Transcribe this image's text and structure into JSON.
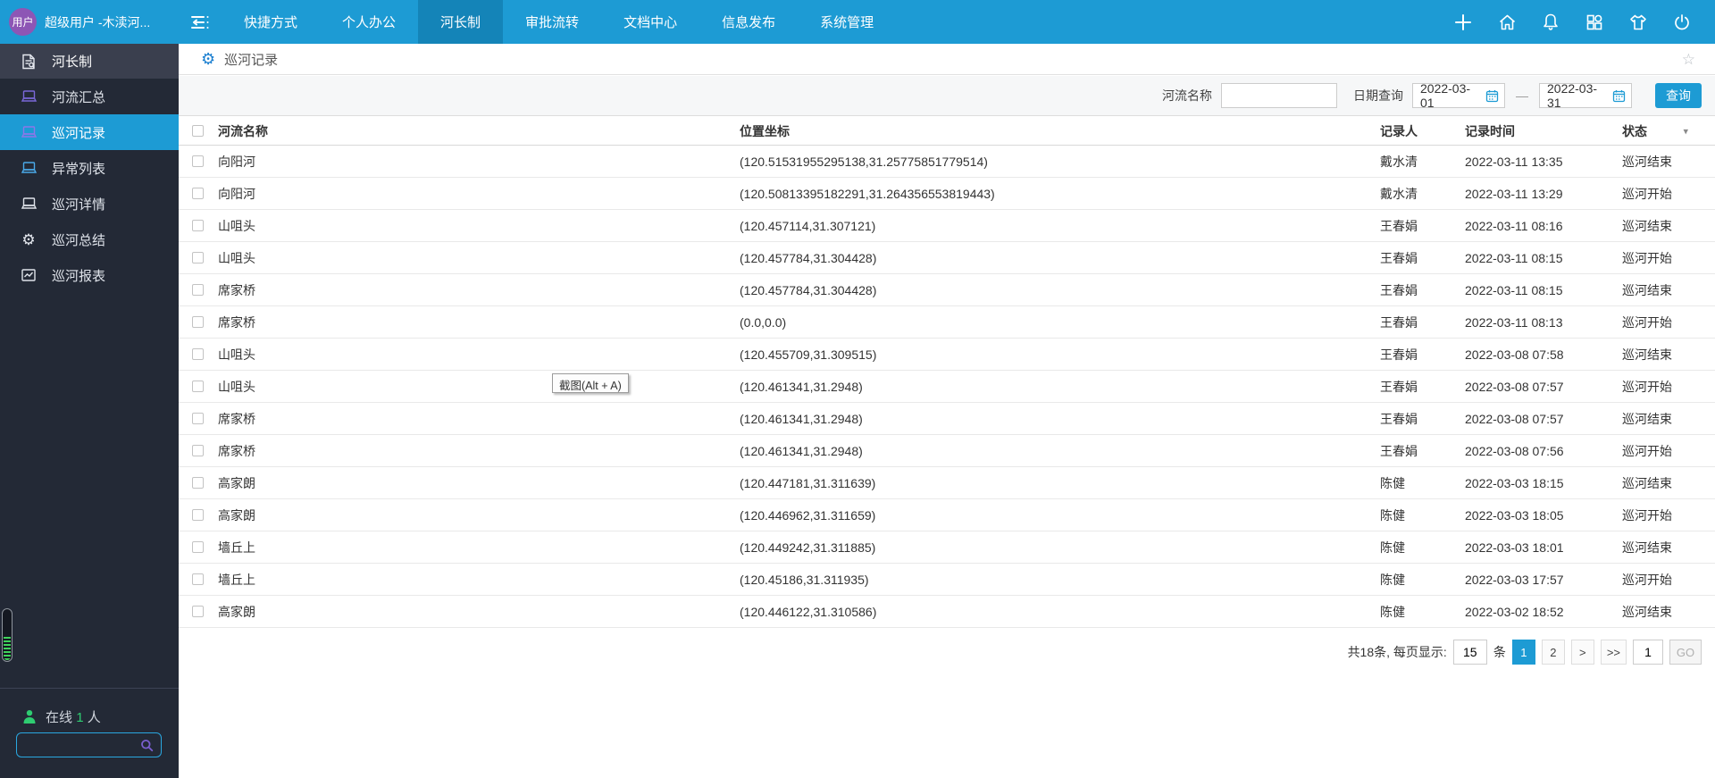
{
  "colors": {
    "accent_blue": "#1d9bd4",
    "active_tab": "#1484b8",
    "avatar_purple": "#8d56b5",
    "sidebar_bg": "#232936",
    "online_green": "#2ecc71",
    "icon_purple": "#7a68d8"
  },
  "topbar": {
    "user_badge": "用户",
    "username": "超级用户 -木渎河...",
    "tabs": [
      {
        "label": "快捷方式"
      },
      {
        "label": "个人办公"
      },
      {
        "label": "河长制",
        "active": true
      },
      {
        "label": "审批流转"
      },
      {
        "label": "文档中心"
      },
      {
        "label": "信息发布"
      },
      {
        "label": "系统管理"
      }
    ],
    "icons": [
      "menu-collapse-icon",
      "plus-icon",
      "home-icon",
      "bell-icon",
      "apps-icon",
      "theme-shirt-icon",
      "power-icon"
    ]
  },
  "sidebar": {
    "header": {
      "label": "河长制",
      "icon": "document-search-icon"
    },
    "items": [
      {
        "label": "河流汇总",
        "icon": "laptop-icon"
      },
      {
        "label": "巡河记录",
        "icon": "laptop-icon",
        "active": true
      },
      {
        "label": "异常列表",
        "icon": "laptop-icon"
      },
      {
        "label": "巡河详情",
        "icon": "laptop-icon"
      },
      {
        "label": "巡河总结",
        "icon": "gear-icon"
      },
      {
        "label": "巡河报表",
        "icon": "report-icon"
      }
    ],
    "online": {
      "prefix": "在线",
      "count": "1",
      "suffix": "人",
      "icon": "person-icon"
    },
    "search": {
      "value": "",
      "icon": "search-icon"
    }
  },
  "breadcrumb": {
    "title": "巡河记录",
    "gear": "settings-gear-icon",
    "star": "☆"
  },
  "filters": {
    "river_name_label": "河流名称",
    "river_name_value": "",
    "date_label": "日期查询",
    "date_from": "2022-03-01",
    "date_to": "2022-03-31",
    "separator": "—",
    "search_button": "查询"
  },
  "table": {
    "columns": {
      "name": "河流名称",
      "coords": "位置坐标",
      "recorder": "记录人",
      "time": "记录时间",
      "status": "状态"
    },
    "sort_caret": "▾",
    "rows": [
      {
        "name": "向阳河",
        "coords": "(120.51531955295138,31.25775851779514)",
        "recorder": "戴水清",
        "time": "2022-03-11 13:35",
        "status": "巡河结束"
      },
      {
        "name": "向阳河",
        "coords": "(120.50813395182291,31.264356553819443)",
        "recorder": "戴水清",
        "time": "2022-03-11 13:29",
        "status": "巡河开始"
      },
      {
        "name": "山咀头",
        "coords": "(120.457114,31.307121)",
        "recorder": "王春娟",
        "time": "2022-03-11 08:16",
        "status": "巡河结束"
      },
      {
        "name": "山咀头",
        "coords": "(120.457784,31.304428)",
        "recorder": "王春娟",
        "time": "2022-03-11 08:15",
        "status": "巡河开始"
      },
      {
        "name": "席家桥",
        "coords": "(120.457784,31.304428)",
        "recorder": "王春娟",
        "time": "2022-03-11 08:15",
        "status": "巡河结束"
      },
      {
        "name": "席家桥",
        "coords": "(0.0,0.0)",
        "recorder": "王春娟",
        "time": "2022-03-11 08:13",
        "status": "巡河开始"
      },
      {
        "name": "山咀头",
        "coords": "(120.455709,31.309515)",
        "recorder": "王春娟",
        "time": "2022-03-08 07:58",
        "status": "巡河结束"
      },
      {
        "name": "山咀头",
        "coords": "(120.461341,31.2948)",
        "recorder": "王春娟",
        "time": "2022-03-08 07:57",
        "status": "巡河开始"
      },
      {
        "name": "席家桥",
        "coords": "(120.461341,31.2948)",
        "recorder": "王春娟",
        "time": "2022-03-08 07:57",
        "status": "巡河结束"
      },
      {
        "name": "席家桥",
        "coords": "(120.461341,31.2948)",
        "recorder": "王春娟",
        "time": "2022-03-08 07:56",
        "status": "巡河开始"
      },
      {
        "name": "高家朗",
        "coords": "(120.447181,31.311639)",
        "recorder": "陈健",
        "time": "2022-03-03 18:15",
        "status": "巡河结束"
      },
      {
        "name": "高家朗",
        "coords": "(120.446962,31.311659)",
        "recorder": "陈健",
        "time": "2022-03-03 18:05",
        "status": "巡河开始"
      },
      {
        "name": "墙丘上",
        "coords": "(120.449242,31.311885)",
        "recorder": "陈健",
        "time": "2022-03-03 18:01",
        "status": "巡河结束"
      },
      {
        "name": "墙丘上",
        "coords": "(120.45186,31.311935)",
        "recorder": "陈健",
        "time": "2022-03-03 17:57",
        "status": "巡河开始"
      },
      {
        "name": "高家朗",
        "coords": "(120.446122,31.310586)",
        "recorder": "陈健",
        "time": "2022-03-02 18:52",
        "status": "巡河结束"
      }
    ]
  },
  "tooltip": {
    "text": "截图(Alt + A)"
  },
  "pagination": {
    "summary": "共18条, 每页显示:",
    "page_size": "15",
    "unit": "条",
    "page1": "1",
    "page2": "2",
    "next": ">",
    "last": ">>",
    "goto_value": "1",
    "go_label": "GO"
  }
}
